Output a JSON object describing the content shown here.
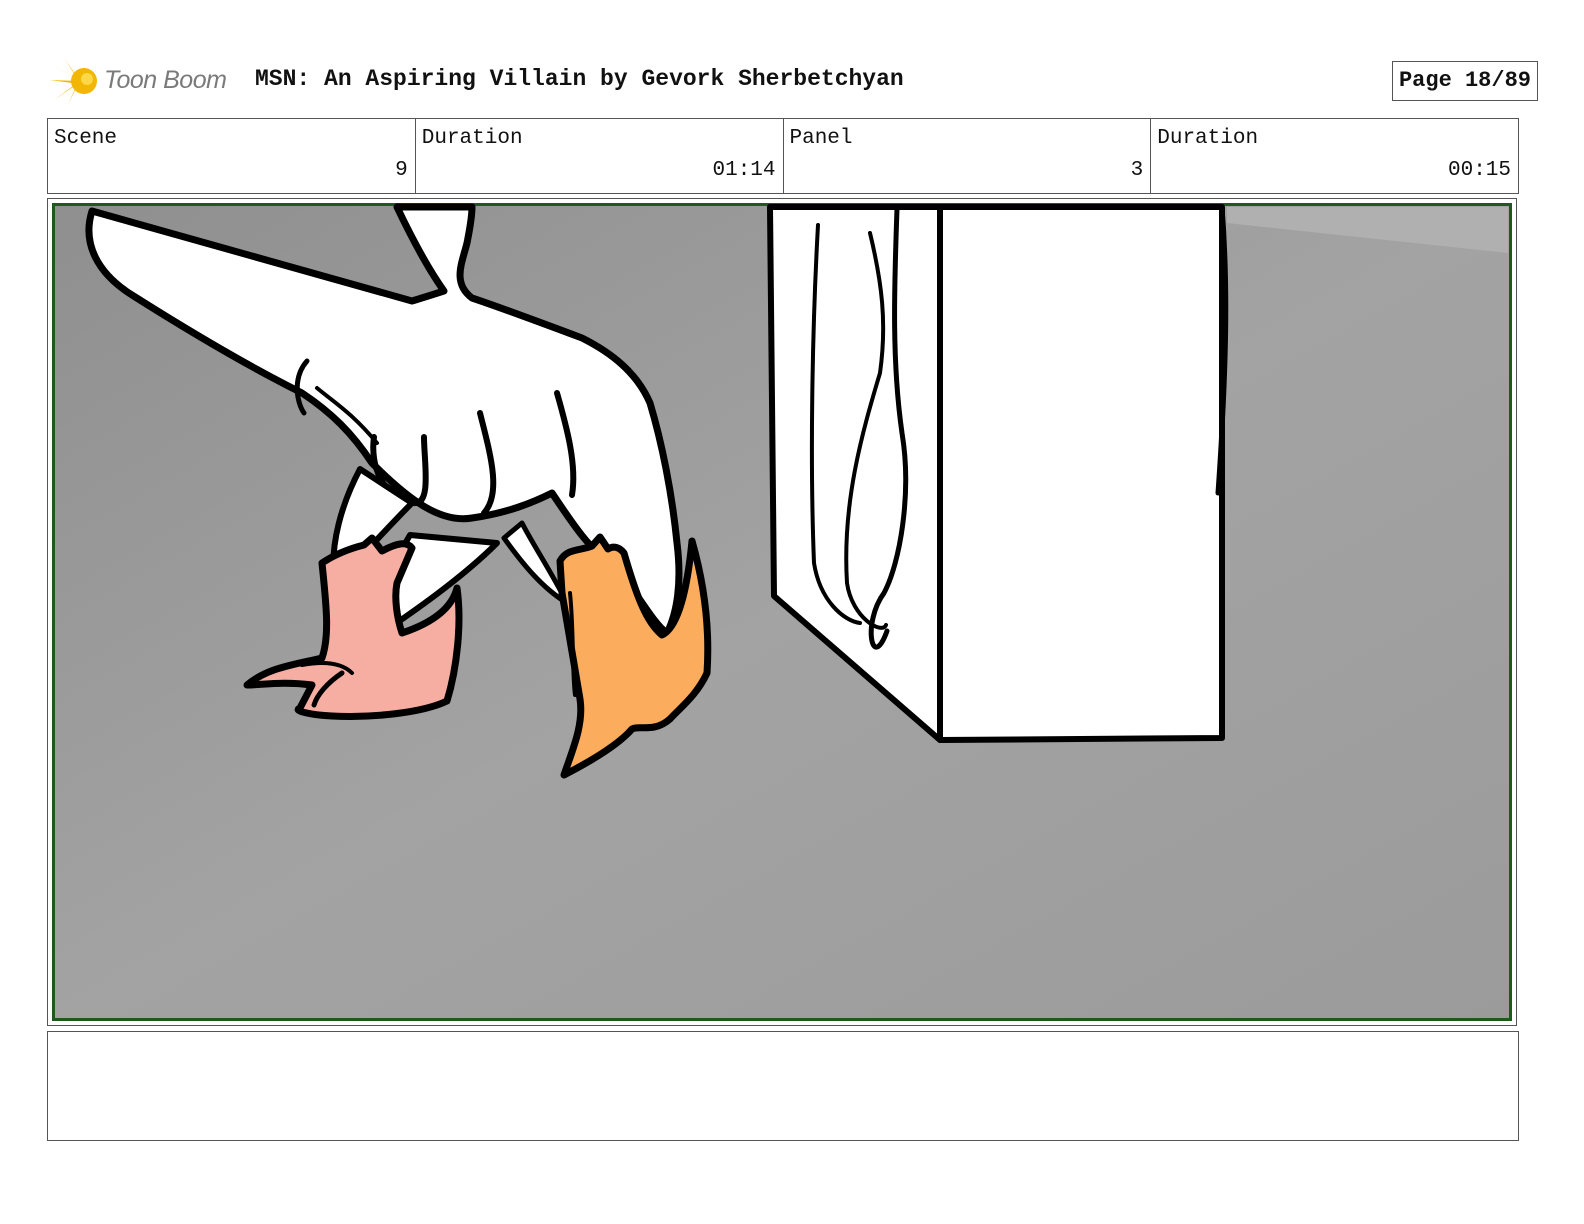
{
  "header": {
    "logo_text": "Toon Boom",
    "title": "MSN: An Aspiring Villain by Gevork Sherbetchyan",
    "page_label": "Page 18/89"
  },
  "info": {
    "scene_label": "Scene",
    "scene_value": "9",
    "scene_duration_label": "Duration",
    "scene_duration_value": "01:14",
    "panel_label": "Panel",
    "panel_value": "3",
    "panel_duration_label": "Duration",
    "panel_duration_value": "00:15"
  },
  "caption": {
    "text": ""
  },
  "colors": {
    "logo_burst": "#f2b705",
    "panel_background": "#9a9a9a",
    "panel_border": "#1e5a1e",
    "foot_pink": "#f6aea2",
    "foot_orange": "#fbad5d"
  },
  "icons": {
    "logo": "toon-boom-burst-icon"
  }
}
